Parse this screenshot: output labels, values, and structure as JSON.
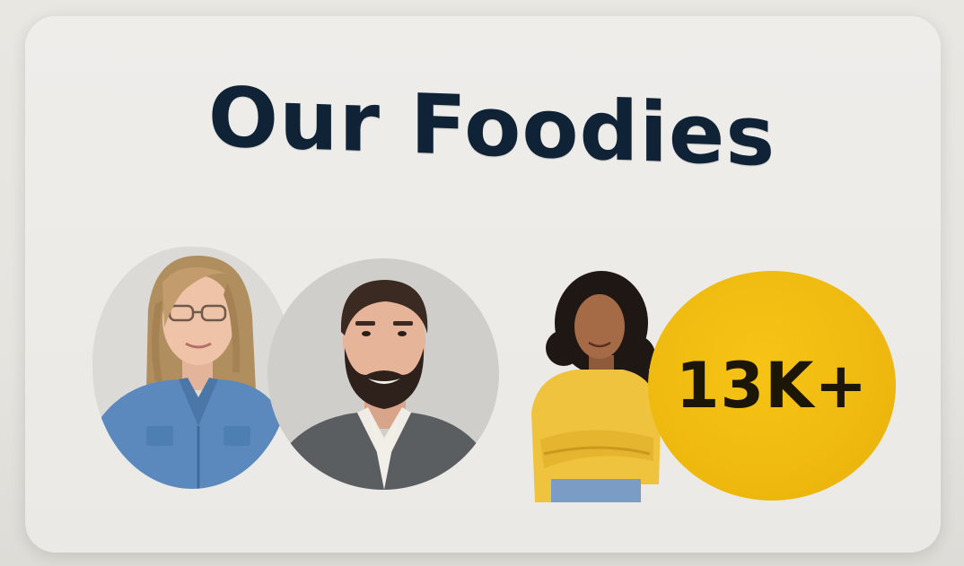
{
  "section": {
    "title": "Our Foodies"
  },
  "foodies": {
    "count_label": "13K+",
    "accent_color": "#f0bb10",
    "avatars": [
      {
        "name": "woman-denim-shirt"
      },
      {
        "name": "man-grey-blazer"
      },
      {
        "name": "woman-yellow-sweater"
      }
    ]
  }
}
